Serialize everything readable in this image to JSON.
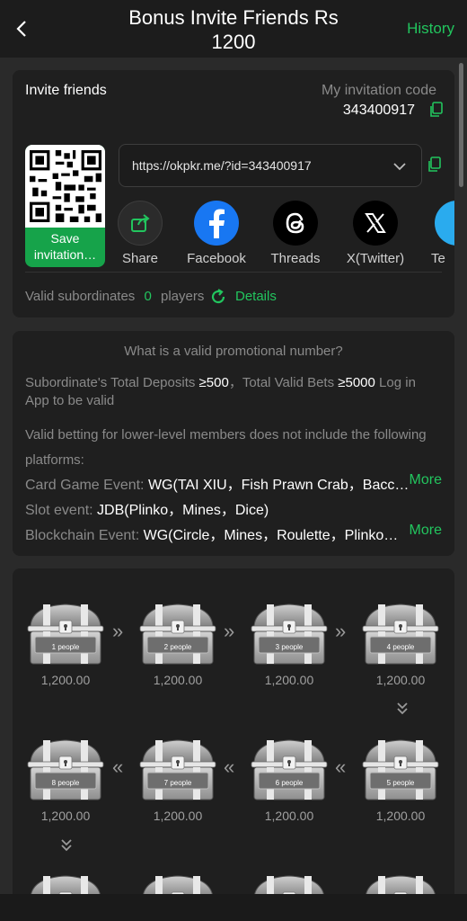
{
  "header": {
    "title_line1": "Bonus Invite Friends Rs",
    "title_line2": "1200",
    "history_label": "History"
  },
  "invite": {
    "title": "Invite friends",
    "code_label": "My invitation code",
    "code": "343400917",
    "url": "https://okpkr.me/?id=343400917",
    "save_label": "Save invitation…",
    "share_items": [
      {
        "label": "Share",
        "icon": "share-icon"
      },
      {
        "label": "Facebook",
        "icon": "facebook-icon"
      },
      {
        "label": "Threads",
        "icon": "threads-icon"
      },
      {
        "label": "X(Twitter)",
        "icon": "x-twitter-icon"
      },
      {
        "label": "Te",
        "icon": "telegram-icon"
      }
    ],
    "subordinates_label": "Valid subordinates",
    "subordinates_count": "0",
    "players_label": "players",
    "details_label": "Details"
  },
  "promo": {
    "heading": "What is a valid promotional number?",
    "rule_prefix": "Subordinate's Total Deposits ",
    "rule_deposit": "≥500",
    "rule_mid": "，Total Valid Bets ",
    "rule_bets": "≥5000",
    "rule_suffix_1": " Log in",
    "rule_suffix_2": "App to be valid",
    "excl_line1": "Valid betting for lower-level members does not include the following",
    "excl_line2": "platforms:",
    "events": [
      {
        "label": "Card Game Event: ",
        "value": "WG(TAI XIU，Fish Prawn Crab，Bacc…",
        "more": "More"
      },
      {
        "label": "Slot event: ",
        "value": "JDB(Plinko，Mines，Dice)",
        "more": ""
      },
      {
        "label": "Blockchain Event: ",
        "value": "WG(Circle，Mines，Roulette，Plinko…",
        "more": "More"
      }
    ]
  },
  "rewards": [
    {
      "people": "1 people",
      "amount": "1,200.00"
    },
    {
      "people": "2 people",
      "amount": "1,200.00"
    },
    {
      "people": "3 people",
      "amount": "1,200.00"
    },
    {
      "people": "4 people",
      "amount": "1,200.00"
    },
    {
      "people": "5 people",
      "amount": "1,200.00"
    },
    {
      "people": "6 people",
      "amount": "1,200.00"
    },
    {
      "people": "7 people",
      "amount": "1,200.00"
    },
    {
      "people": "8 people",
      "amount": "1,200.00"
    }
  ],
  "colors": {
    "accent": "#22c55e",
    "background": "#2a2a2a",
    "card": "#1f1f1f"
  }
}
